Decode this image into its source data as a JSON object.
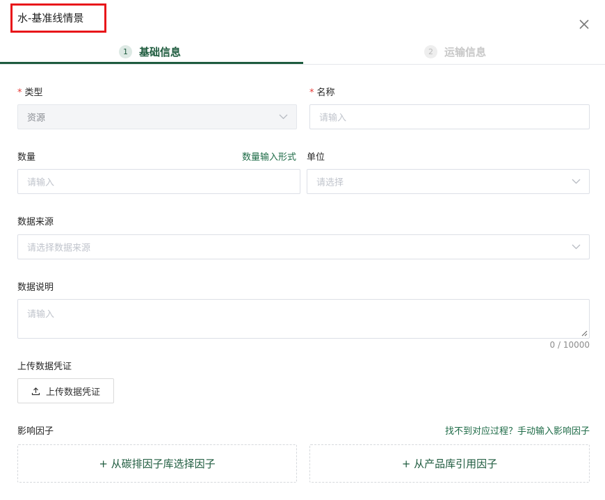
{
  "dialog": {
    "title": "水-基准线情景"
  },
  "steps": [
    {
      "number": "1",
      "label": "基础信息"
    },
    {
      "number": "2",
      "label": "运输信息"
    }
  ],
  "form": {
    "type": {
      "label": "类型",
      "value": "资源"
    },
    "name": {
      "label": "名称",
      "placeholder": "请输入"
    },
    "quantity": {
      "label": "数量",
      "placeholder": "请输入",
      "mode_link": "数量输入形式"
    },
    "unit": {
      "label": "单位",
      "placeholder": "请选择"
    },
    "data_source": {
      "label": "数据来源",
      "placeholder": "请选择数据来源"
    },
    "data_description": {
      "label": "数据说明",
      "placeholder": "请输入",
      "counter": "0 / 10000"
    },
    "upload": {
      "label": "上传数据凭证",
      "button_label": "上传数据凭证"
    },
    "factors": {
      "label": "影响因子",
      "manual_link": "找不到对应过程？手动输入影响因子",
      "from_carbon_library": "+ 从碳排因子库选择因子",
      "from_product_library": "+ 从产品库引用因子"
    }
  },
  "colors": {
    "accent": "#1e5b3e",
    "required": "#e53935",
    "highlight_box": "#e8161a"
  }
}
